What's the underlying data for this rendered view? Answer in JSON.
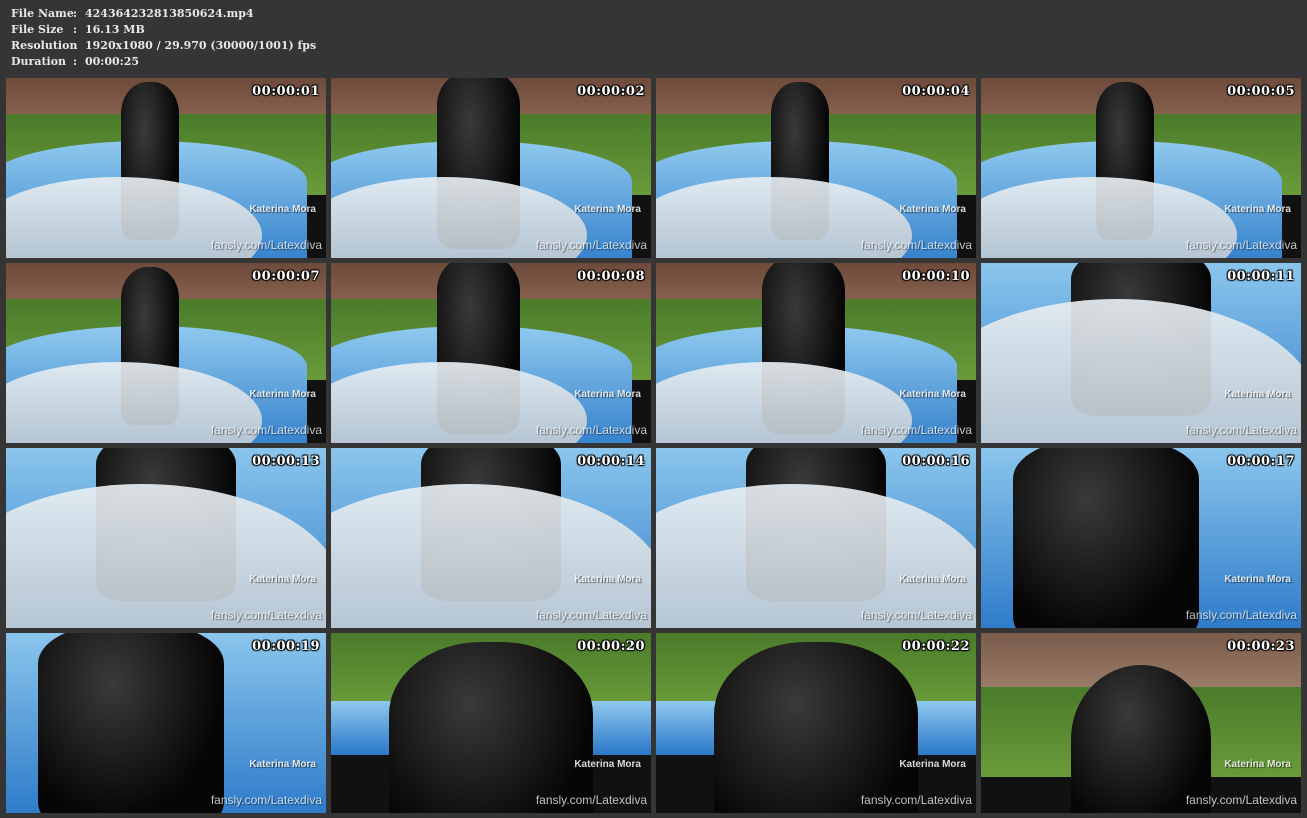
{
  "file_info": {
    "file_name_label": "File Name",
    "file_name": "424364232813850624.mp4",
    "file_size_label": "File Size",
    "file_size": "16.13 MB",
    "resolution_label": "Resolution",
    "resolution": "1920x1080 / 29.970 (30000/1001) fps",
    "duration_label": "Duration",
    "duration": "00:00:25",
    "separator": ":"
  },
  "watermark": {
    "name": "Katerina Mora",
    "url": "fansly.com/Latexdiva"
  },
  "thumbnails": [
    {
      "timestamp": "00:00:01"
    },
    {
      "timestamp": "00:00:02"
    },
    {
      "timestamp": "00:00:04"
    },
    {
      "timestamp": "00:00:05"
    },
    {
      "timestamp": "00:00:07"
    },
    {
      "timestamp": "00:00:08"
    },
    {
      "timestamp": "00:00:10"
    },
    {
      "timestamp": "00:00:11"
    },
    {
      "timestamp": "00:00:13"
    },
    {
      "timestamp": "00:00:14"
    },
    {
      "timestamp": "00:00:16"
    },
    {
      "timestamp": "00:00:17"
    },
    {
      "timestamp": "00:00:19"
    },
    {
      "timestamp": "00:00:20"
    },
    {
      "timestamp": "00:00:22"
    },
    {
      "timestamp": "00:00:23"
    }
  ],
  "colors": {
    "background": "#353535",
    "text": "#e8e8e8",
    "timestamp": "#ffffff"
  }
}
